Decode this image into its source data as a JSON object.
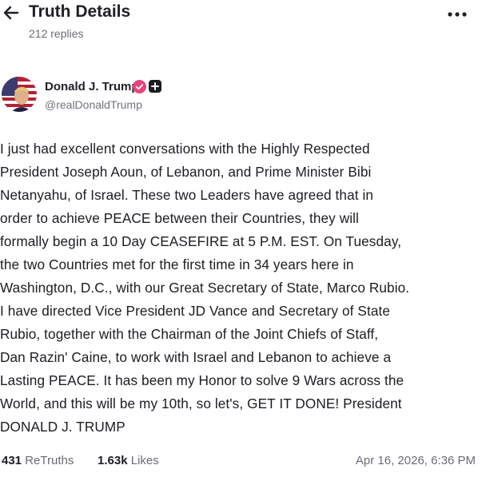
{
  "header": {
    "title": "Truth Details",
    "reply_count": "212 replies"
  },
  "author": {
    "name": "Donald J. Trump",
    "handle": "@realDonaldTrump",
    "badge_color": "#e8447a"
  },
  "post": {
    "lines": [
      "I just had excellent conversations with the Highly Respected",
      "President Joseph Aoun, of Lebanon, and Prime Minister Bibi",
      "Netanyahu, of Israel. These two Leaders have agreed that in",
      "order to achieve PEACE between their Countries, they will",
      "formally begin a 10 Day CEASEFIRE at 5 P.M. EST. On Tuesday,",
      "the two Countries met for the first time in 34 years here in",
      "Washington, D.C., with our Great Secretary of State, Marco Rubio.",
      "I have directed Vice President JD Vance and Secretary of State",
      "Rubio, together with the Chairman of the Joint Chiefs of Staff,",
      "Dan Razin' Caine, to work with Israel and Lebanon to achieve a",
      "Lasting PEACE. It has been my Honor to solve 9 Wars across the",
      "World, and this will be my 10th, so let's, GET IT DONE! President",
      "DONALD J. TRUMP"
    ]
  },
  "footer": {
    "retruths_count": "431",
    "retruths_label": "ReTruths",
    "likes_count": "1.63k",
    "likes_label": "Likes",
    "timestamp": "Apr 16, 2026, 6:36 PM"
  },
  "icons": {
    "back": "arrow-left-icon",
    "more": "ellipsis-icon",
    "verified": "verified-badge-icon",
    "plus": "plus-badge-icon"
  }
}
